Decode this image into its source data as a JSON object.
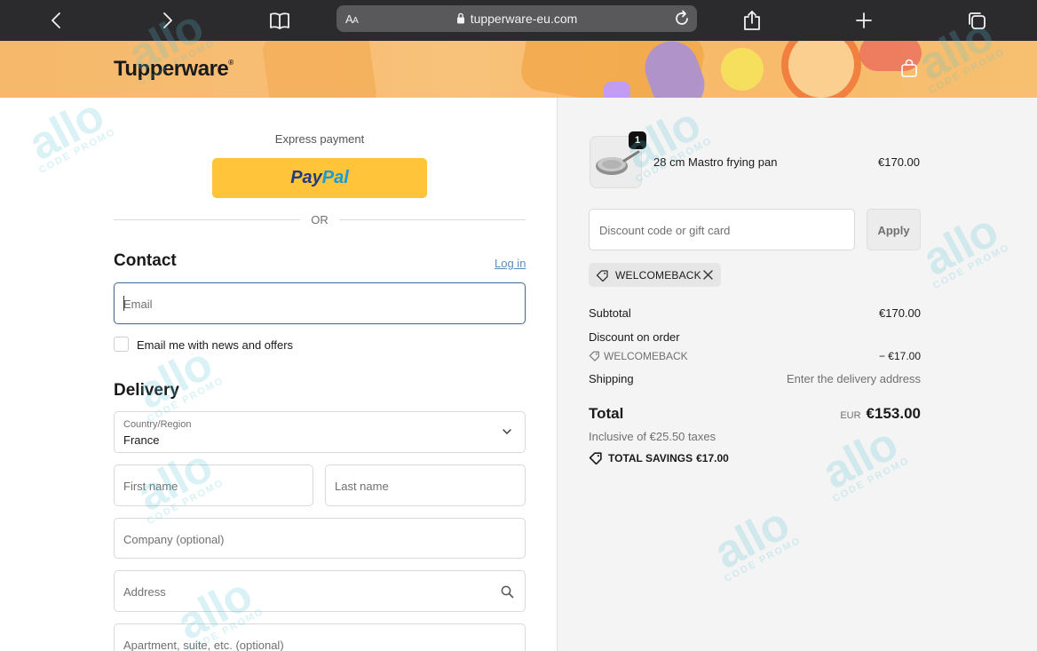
{
  "browser": {
    "aa_label_big": "A",
    "aa_label_small": "A",
    "url": "tupperware-eu.com"
  },
  "header": {
    "logo_text": "Tupperware",
    "logo_mark": "®"
  },
  "checkout": {
    "express_payment_label": "Express payment",
    "paypal_pay": "Pay",
    "paypal_pal": "Pal",
    "or_label": "OR",
    "contact_heading": "Contact",
    "login_link": "Log in",
    "email_placeholder": "Email",
    "newsletter_label": "Email me with news and offers",
    "delivery_heading": "Delivery",
    "country_label": "Country/Region",
    "country_value": "France",
    "first_name_placeholder": "First name",
    "last_name_placeholder": "Last name",
    "company_placeholder": "Company (optional)",
    "address_placeholder": "Address",
    "apartment_placeholder": "Apartment, suite, etc. (optional)"
  },
  "order_summary": {
    "item": {
      "quantity": "1",
      "name": "28 cm Mastro frying pan",
      "price": "€170.00"
    },
    "discount_placeholder": "Discount code or gift card",
    "apply_label": "Apply",
    "applied_code": "WELCOMEBACK",
    "subtotal_label": "Subtotal",
    "subtotal_value": "€170.00",
    "discount_label": "Discount on order",
    "discount_code": "WELCOMEBACK",
    "discount_value": "− €17.00",
    "shipping_label": "Shipping",
    "shipping_value": "Enter the delivery address",
    "total_label": "Total",
    "total_currency": "EUR",
    "total_value": "€153.00",
    "taxes_note": "Inclusive of €25.50 taxes",
    "savings_label": "TOTAL SAVINGS",
    "savings_value": "€17.00"
  },
  "watermark": {
    "big": "allo",
    "small": "CODE PROMO"
  },
  "colors": {
    "browser_bar": "#2b2b2d",
    "paypal_yellow": "#ffc439",
    "link_blue": "#5b8fc0",
    "summary_bg": "#f4f4f4"
  }
}
